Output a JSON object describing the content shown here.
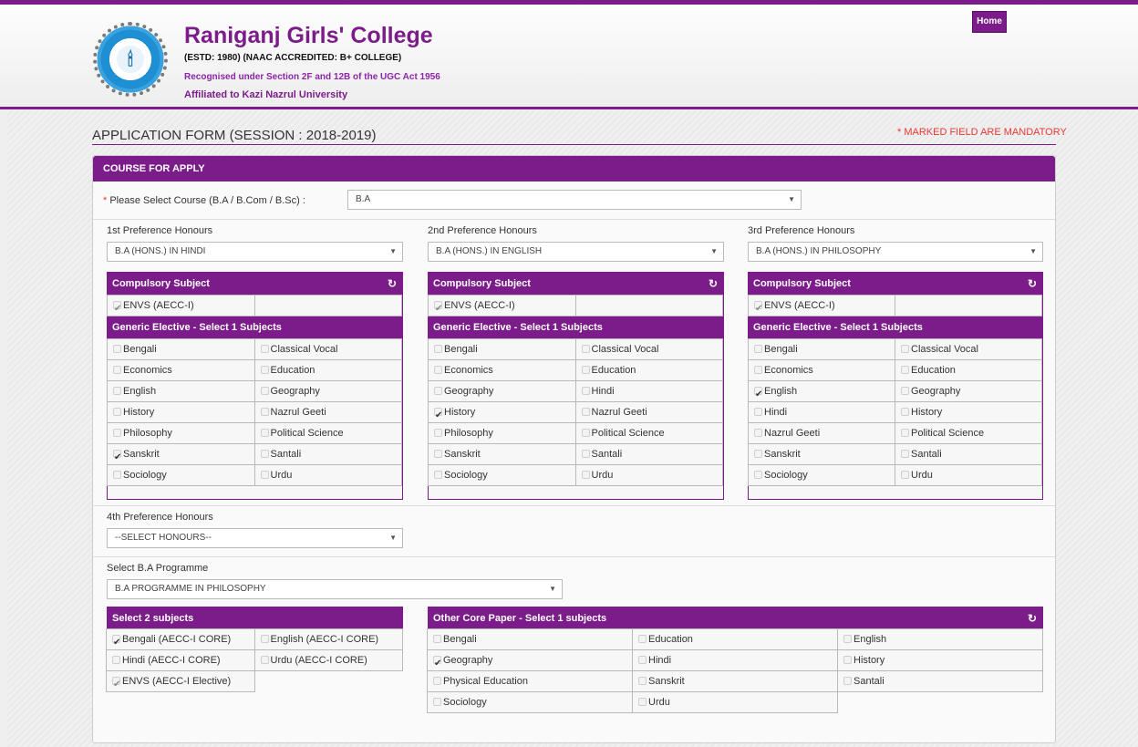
{
  "header": {
    "college_name": "Raniganj Girls' College",
    "estd": "(ESTD: 1980) (NAAC ACCREDITED: B+ COLLEGE)",
    "recognised": "Recognised under Section 2F and 12B of the UGC Act 1956",
    "affiliated": "Affiliated to Kazi Nazrul University",
    "home_label": "Home"
  },
  "form": {
    "title": "APPLICATION FORM (SESSION : 2018-2019)",
    "mandatory_note": "* MARKED FIELD ARE MANDATORY",
    "panel_title": "COURSE FOR APPLY",
    "course_label": "Please Select Course (B.A / B.Com / B.Sc) :",
    "course_required": "*",
    "course_value": "B.A"
  },
  "common": {
    "compulsory_title": "Compulsory Subject",
    "compulsory_item": "ENVS (AECC-I)",
    "ge_title": "Generic Elective - Select 1 Subjects",
    "refresh_icon": "↻",
    "arrow": "▼"
  },
  "pref1": {
    "label": "1st Preference Honours",
    "value": "B.A (HONS.) IN HINDI",
    "subjects": [
      {
        "name": "Bengali",
        "checked": false
      },
      {
        "name": "Classical Vocal",
        "checked": false
      },
      {
        "name": "Economics",
        "checked": false
      },
      {
        "name": "Education",
        "checked": false
      },
      {
        "name": "English",
        "checked": false
      },
      {
        "name": "Geography",
        "checked": false
      },
      {
        "name": "History",
        "checked": false
      },
      {
        "name": "Nazrul Geeti",
        "checked": false
      },
      {
        "name": "Philosophy",
        "checked": false
      },
      {
        "name": "Political Science",
        "checked": false
      },
      {
        "name": "Sanskrit",
        "checked": true
      },
      {
        "name": "Santali",
        "checked": false
      },
      {
        "name": "Sociology",
        "checked": false
      },
      {
        "name": "Urdu",
        "checked": false
      }
    ]
  },
  "pref2": {
    "label": "2nd Preference Honours",
    "value": "B.A (HONS.) IN ENGLISH",
    "subjects": [
      {
        "name": "Bengali",
        "checked": false
      },
      {
        "name": "Classical Vocal",
        "checked": false
      },
      {
        "name": "Economics",
        "checked": false
      },
      {
        "name": "Education",
        "checked": false
      },
      {
        "name": "Geography",
        "checked": false
      },
      {
        "name": "Hindi",
        "checked": false
      },
      {
        "name": "History",
        "checked": true
      },
      {
        "name": "Nazrul Geeti",
        "checked": false
      },
      {
        "name": "Philosophy",
        "checked": false
      },
      {
        "name": "Political Science",
        "checked": false
      },
      {
        "name": "Sanskrit",
        "checked": false
      },
      {
        "name": "Santali",
        "checked": false
      },
      {
        "name": "Sociology",
        "checked": false
      },
      {
        "name": "Urdu",
        "checked": false
      }
    ]
  },
  "pref3": {
    "label": "3rd Preference Honours",
    "value": "B.A (HONS.) IN PHILOSOPHY",
    "subjects": [
      {
        "name": "Bengali",
        "checked": false
      },
      {
        "name": "Classical Vocal",
        "checked": false
      },
      {
        "name": "Economics",
        "checked": false
      },
      {
        "name": "Education",
        "checked": false
      },
      {
        "name": "English",
        "checked": true
      },
      {
        "name": "Geography",
        "checked": false
      },
      {
        "name": "Hindi",
        "checked": false
      },
      {
        "name": "History",
        "checked": false
      },
      {
        "name": "Nazrul Geeti",
        "checked": false
      },
      {
        "name": "Political Science",
        "checked": false
      },
      {
        "name": "Sanskrit",
        "checked": false
      },
      {
        "name": "Santali",
        "checked": false
      },
      {
        "name": "Sociology",
        "checked": false
      },
      {
        "name": "Urdu",
        "checked": false
      }
    ]
  },
  "pref4": {
    "label": "4th Preference Honours",
    "value": "--SELECT HONOURS--"
  },
  "programme": {
    "label": "Select B.A Programme",
    "value": "B.A PROGRAMME IN PHILOSOPHY",
    "select2_title": "Select 2 subjects",
    "select2": [
      {
        "name": "Bengali (AECC-I CORE)",
        "checked": true
      },
      {
        "name": "English (AECC-I CORE)",
        "checked": false
      },
      {
        "name": "Hindi (AECC-I CORE)",
        "checked": false
      },
      {
        "name": "Urdu (AECC-I CORE)",
        "checked": false
      },
      {
        "name": "ENVS (AECC-I Elective)",
        "checked": true,
        "locked": true
      }
    ],
    "core_title": "Other Core Paper - Select 1 subjects",
    "core": [
      {
        "name": "Bengali",
        "checked": false
      },
      {
        "name": "Education",
        "checked": false
      },
      {
        "name": "English",
        "checked": false
      },
      {
        "name": "Geography",
        "checked": true
      },
      {
        "name": "Hindi",
        "checked": false
      },
      {
        "name": "History",
        "checked": false
      },
      {
        "name": "Physical Education",
        "checked": false
      },
      {
        "name": "Sanskrit",
        "checked": false
      },
      {
        "name": "Santali",
        "checked": false
      },
      {
        "name": "Sociology",
        "checked": false
      },
      {
        "name": "Urdu",
        "checked": false
      }
    ]
  }
}
